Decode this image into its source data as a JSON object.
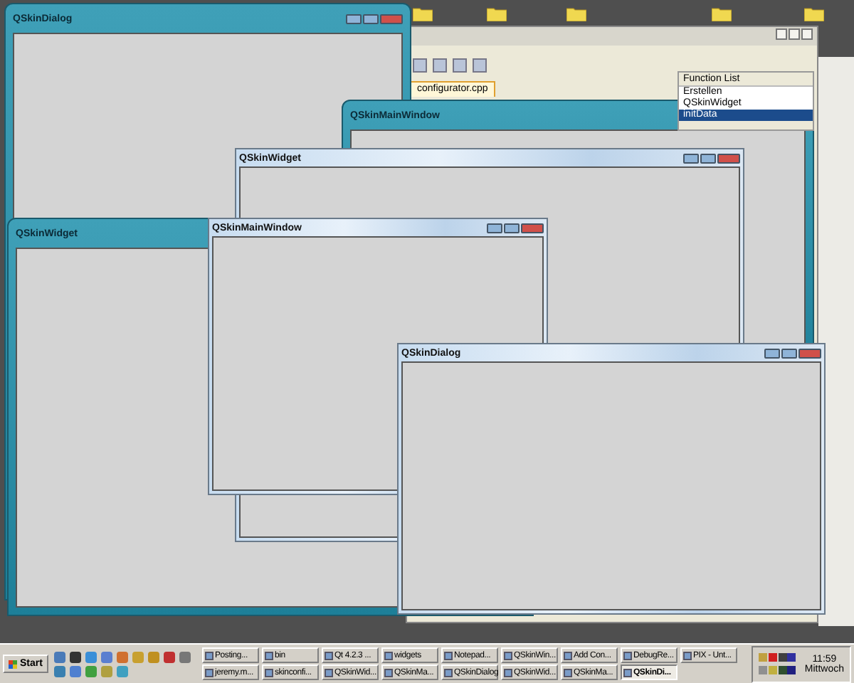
{
  "editor": {
    "tabs": [
      {
        "label": "configurator.cpp",
        "selected": true
      }
    ],
    "function_list": {
      "title": "Function List",
      "items": [
        {
          "label": "Erstellen",
          "selected": false
        },
        {
          "label": "QSkinWidget",
          "selected": false
        },
        {
          "label": "initData",
          "selected": true
        }
      ]
    }
  },
  "windows": [
    {
      "title": "QSkinDialog",
      "kind": "teal"
    },
    {
      "title": "QSkinMainWindow",
      "kind": "teal"
    },
    {
      "title": "QSkinWidget",
      "kind": "teal"
    },
    {
      "title": "QSkinWidget",
      "kind": "light"
    },
    {
      "title": "QSkinMainWindow",
      "kind": "light"
    },
    {
      "title": "QSkinDialog",
      "kind": "light"
    }
  ],
  "taskbar": {
    "start": "Start",
    "tasks": [
      {
        "label": "Posting...",
        "selected": false
      },
      {
        "label": "bin",
        "selected": false
      },
      {
        "label": "Qt 4.2.3 ...",
        "selected": false
      },
      {
        "label": "widgets",
        "selected": false
      },
      {
        "label": "Notepad...",
        "selected": false
      },
      {
        "label": "QSkinWin...",
        "selected": false
      },
      {
        "label": "Add Con...",
        "selected": false
      },
      {
        "label": "DebugRe...",
        "selected": false
      },
      {
        "label": "PIX - Unt...",
        "selected": false
      },
      {
        "label": "jeremy.m...",
        "selected": false
      },
      {
        "label": "skinconfi...",
        "selected": false
      },
      {
        "label": "QSkinWid...",
        "selected": false
      },
      {
        "label": "QSkinMa...",
        "selected": false
      },
      {
        "label": "QSkinDialog",
        "selected": false
      },
      {
        "label": "QSkinWid...",
        "selected": false
      },
      {
        "label": "QSkinMa...",
        "selected": false
      },
      {
        "label": "QSkinDi...",
        "selected": true
      }
    ],
    "clock": "11:59",
    "day": "Mittwoch"
  }
}
